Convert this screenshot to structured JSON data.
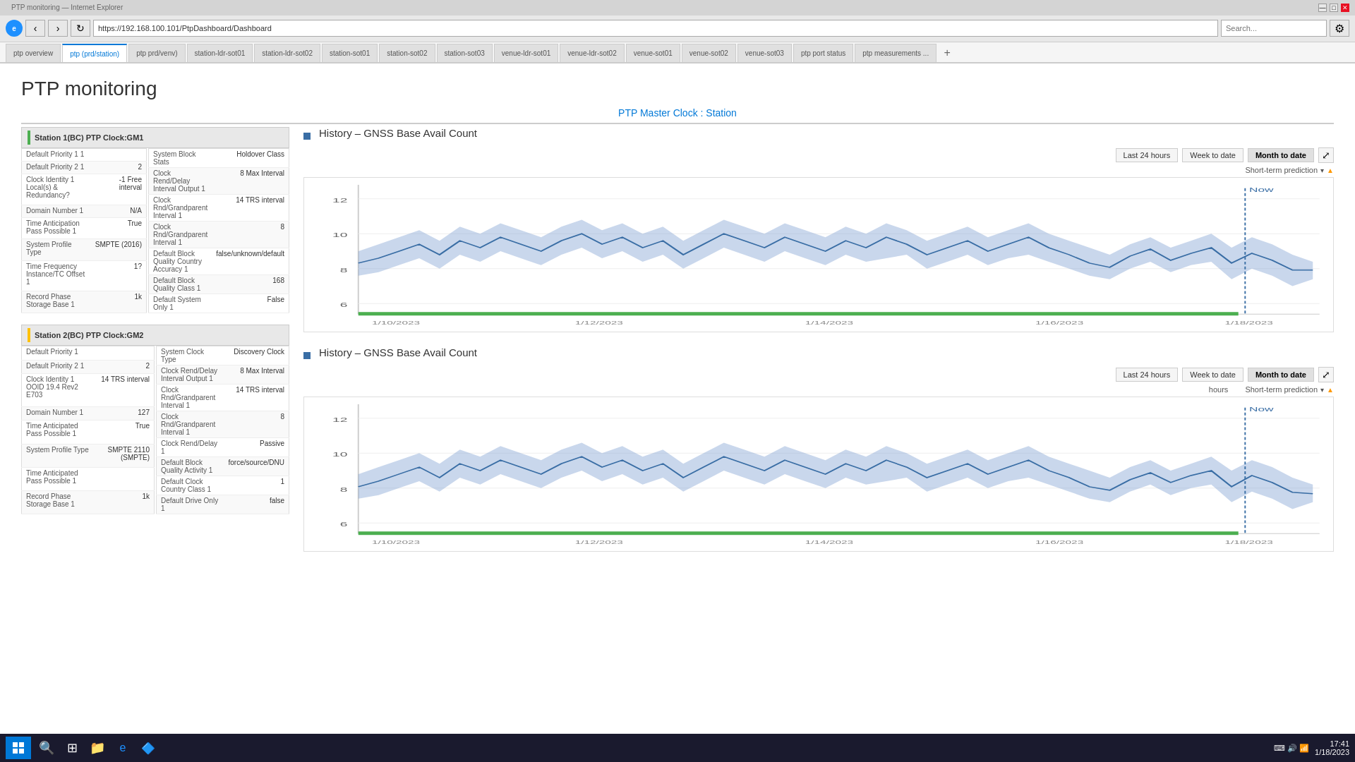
{
  "browser": {
    "address": "https://192.168.100.101/PtpDashboard/Dashboard",
    "search_placeholder": "Search...",
    "title": "PTP monitoring"
  },
  "tabs": [
    {
      "label": "ptp overview",
      "active": false
    },
    {
      "label": "ptp (prd/station)",
      "active": true
    },
    {
      "label": "ptp prd/venv)",
      "active": false
    },
    {
      "label": "station-ldr-sot01",
      "active": false
    },
    {
      "label": "station-ldr-sot02",
      "active": false
    },
    {
      "label": "station-sot01",
      "active": false
    },
    {
      "label": "station-sot02",
      "active": false
    },
    {
      "label": "station-sot03",
      "active": false
    },
    {
      "label": "venue-ldr-sot01",
      "active": false
    },
    {
      "label": "venue-ldr-sot02",
      "active": false
    },
    {
      "label": "venue-sot01",
      "active": false
    },
    {
      "label": "venue-sot02",
      "active": false
    },
    {
      "label": "venue-sot03",
      "active": false
    },
    {
      "label": "ptp port status",
      "active": false
    },
    {
      "label": "ptp measurements ...",
      "active": false
    }
  ],
  "page": {
    "title": "PTP monitoring",
    "master_clock_label": "PTP Master Clock : Station"
  },
  "station1": {
    "header": "Station 1(BC) PTP Clock:GM1",
    "bar_color": "green",
    "rows_left": [
      {
        "label": "Default Priority 1 1",
        "value": ""
      },
      {
        "label": "Default Priority 2 1",
        "value": "2"
      },
      {
        "label": "Clock Identity 1  Local(s) & Redundancy?",
        "value": "-1 Free interval"
      },
      {
        "label": "Domain Number 1",
        "value": "N/A"
      },
      {
        "label": "Time Anticipation Pass Possible 1",
        "value": "True"
      },
      {
        "label": "System Profile Type",
        "value": "SMPTE (2016)"
      },
      {
        "label": "Time Frequency Instance/TC Offset 1",
        "value": "1?"
      },
      {
        "label": "Record Phase Storage Base 1",
        "value": "1k"
      }
    ],
    "rows_right": [
      {
        "label": "System Block Stats",
        "value": "Holdover Class"
      },
      {
        "label": "Clock Rend/Delay Interval Output 1",
        "value": "8 Max Interval"
      },
      {
        "label": "Clock Rnd/Grandparent Interval 1",
        "value": "14 TRS interval"
      },
      {
        "label": "Clock Rnd/Grandparent Interval 1",
        "value": "8"
      },
      {
        "label": "Default Block Quality Country Accuracy 1",
        "value": "false/unknown/default"
      },
      {
        "label": "Default Block Quality Class 1",
        "value": "168"
      },
      {
        "label": "Default System Only 1",
        "value": "False"
      }
    ]
  },
  "station2": {
    "header": "Station 2(BC) PTP Clock:GM2",
    "bar_color": "yellow",
    "rows_left": [
      {
        "label": "Default Priority 1",
        "value": ""
      },
      {
        "label": "Default Priority 2 1",
        "value": "2"
      },
      {
        "label": "Clock Identity 1  OOID 19.4 Rev2 E703",
        "value": "14 TRS interval"
      },
      {
        "label": "Domain Number 1",
        "value": "127"
      },
      {
        "label": "Time Anticipated Pass Possible 1",
        "value": "True"
      },
      {
        "label": "System Profile Type",
        "value": "SMPTE 2110 (SMPTE)"
      },
      {
        "label": "Time Anticipated Pass Possible 1",
        "value": ""
      },
      {
        "label": "Record Phase Storage Base 1",
        "value": "1k"
      }
    ],
    "rows_right": [
      {
        "label": "System Clock Type",
        "value": "Discovery Clock"
      },
      {
        "label": "Clock Rend/Delay Interval Output 1",
        "value": "8 Max Interval"
      },
      {
        "label": "Clock Rnd/Grandparent Interval 1",
        "value": "14 TRS interval"
      },
      {
        "label": "Clock Rnd/Grandparent Interval 1",
        "value": "8"
      },
      {
        "label": "Clock Rend/Delay 1",
        "value": "Passive"
      },
      {
        "label": "Default Block Quality Activity 1",
        "value": "force/source/DNU"
      },
      {
        "label": "Default Clock Country Class 1",
        "value": "1"
      },
      {
        "label": "Default Drive Only 1",
        "value": "false"
      }
    ]
  },
  "chart1": {
    "title": "History – GNSS Base Avail Count",
    "btn_24h": "Last 24 hours",
    "btn_week": "Week to date",
    "btn_month": "Month to date",
    "short_term": "Short-term prediction",
    "y_labels": [
      "6",
      "8",
      "10",
      "12"
    ],
    "now_label": "Now"
  },
  "chart2": {
    "title": "History – GNSS Base Avail Count",
    "btn_24h": "Last 24 hours",
    "btn_week": "Week to date",
    "btn_month": "Month to date",
    "short_term": "Short-term prediction",
    "y_labels": [
      "6",
      "8",
      "10",
      "12"
    ],
    "now_label": "Now",
    "hours_label": "hours"
  },
  "taskbar": {
    "time": "17:41",
    "date": "1/18/2023"
  }
}
